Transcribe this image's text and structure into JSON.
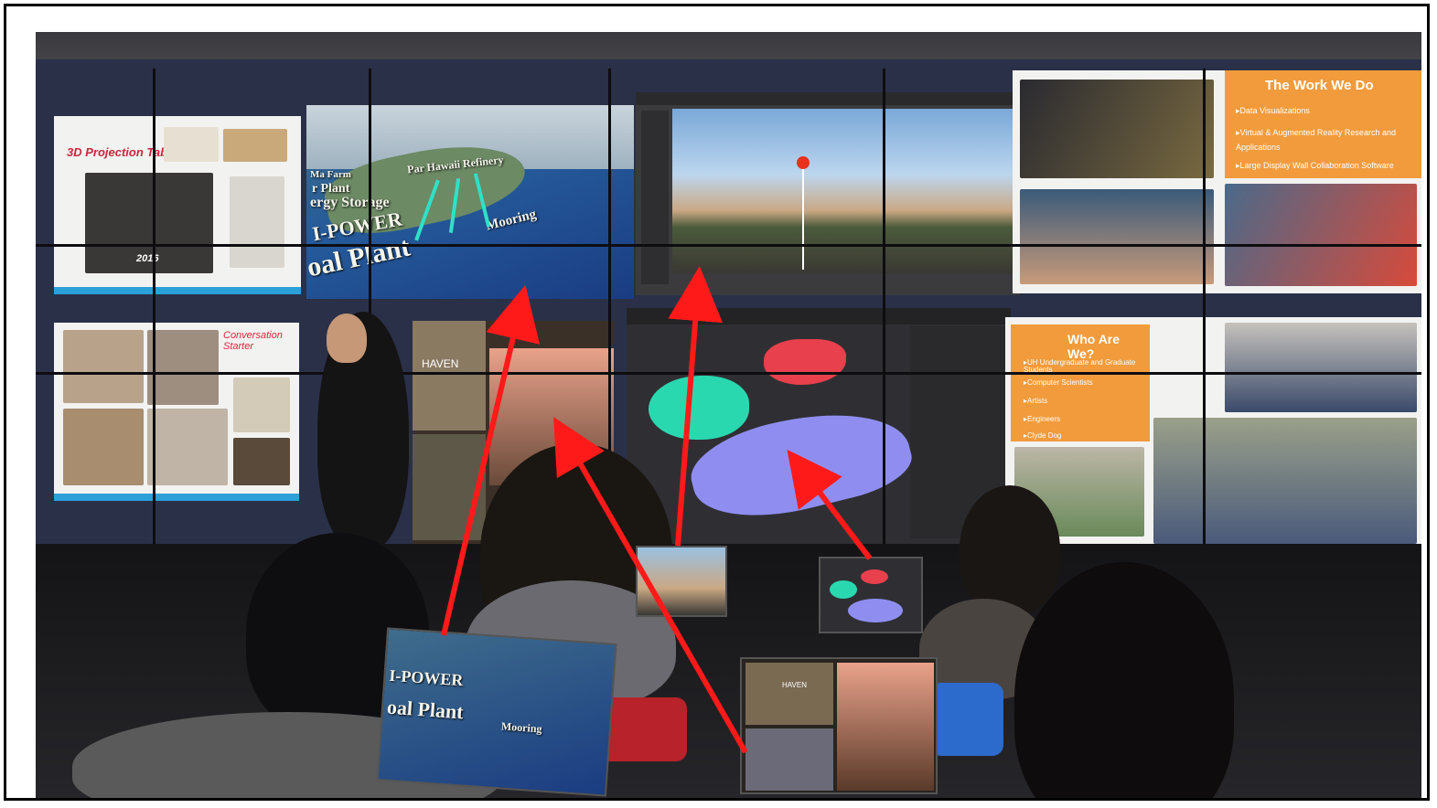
{
  "scene": {
    "description_none": "",
    "slides": {
      "projection_table": {
        "title": "3D Projection Table",
        "year": "2016"
      },
      "conversation": {
        "title": "Conversation Starter"
      },
      "work_we_do": {
        "title": "The Work We Do",
        "bullets": [
          "Data Visualizations",
          "Virtual & Augmented Reality Research and Applications",
          "Large Display Wall Collaboration Software"
        ]
      },
      "who_are_we": {
        "title": "Who Are We?",
        "bullets": [
          "UH Undergraduate and Graduate Students",
          "Computer Scientists",
          "Artists",
          "Engineers",
          "Clyde Dog"
        ]
      },
      "map_labels": {
        "storage": "ergy Storage",
        "power": "I-POWER",
        "plant": "oal Plant",
        "mooring": "Mooring",
        "kalaeloa": "Par Hawaii Refinery",
        "farm": "Ma Farm",
        "plant2": "r Plant"
      },
      "haven": "HAVEN"
    },
    "colors": {
      "arrow": "#ff1a1a",
      "orange_slide": "#f29b3c",
      "teal_island": "#2ad8b0",
      "red_island": "#e8404c",
      "purple_island": "#8f8ef0"
    }
  }
}
